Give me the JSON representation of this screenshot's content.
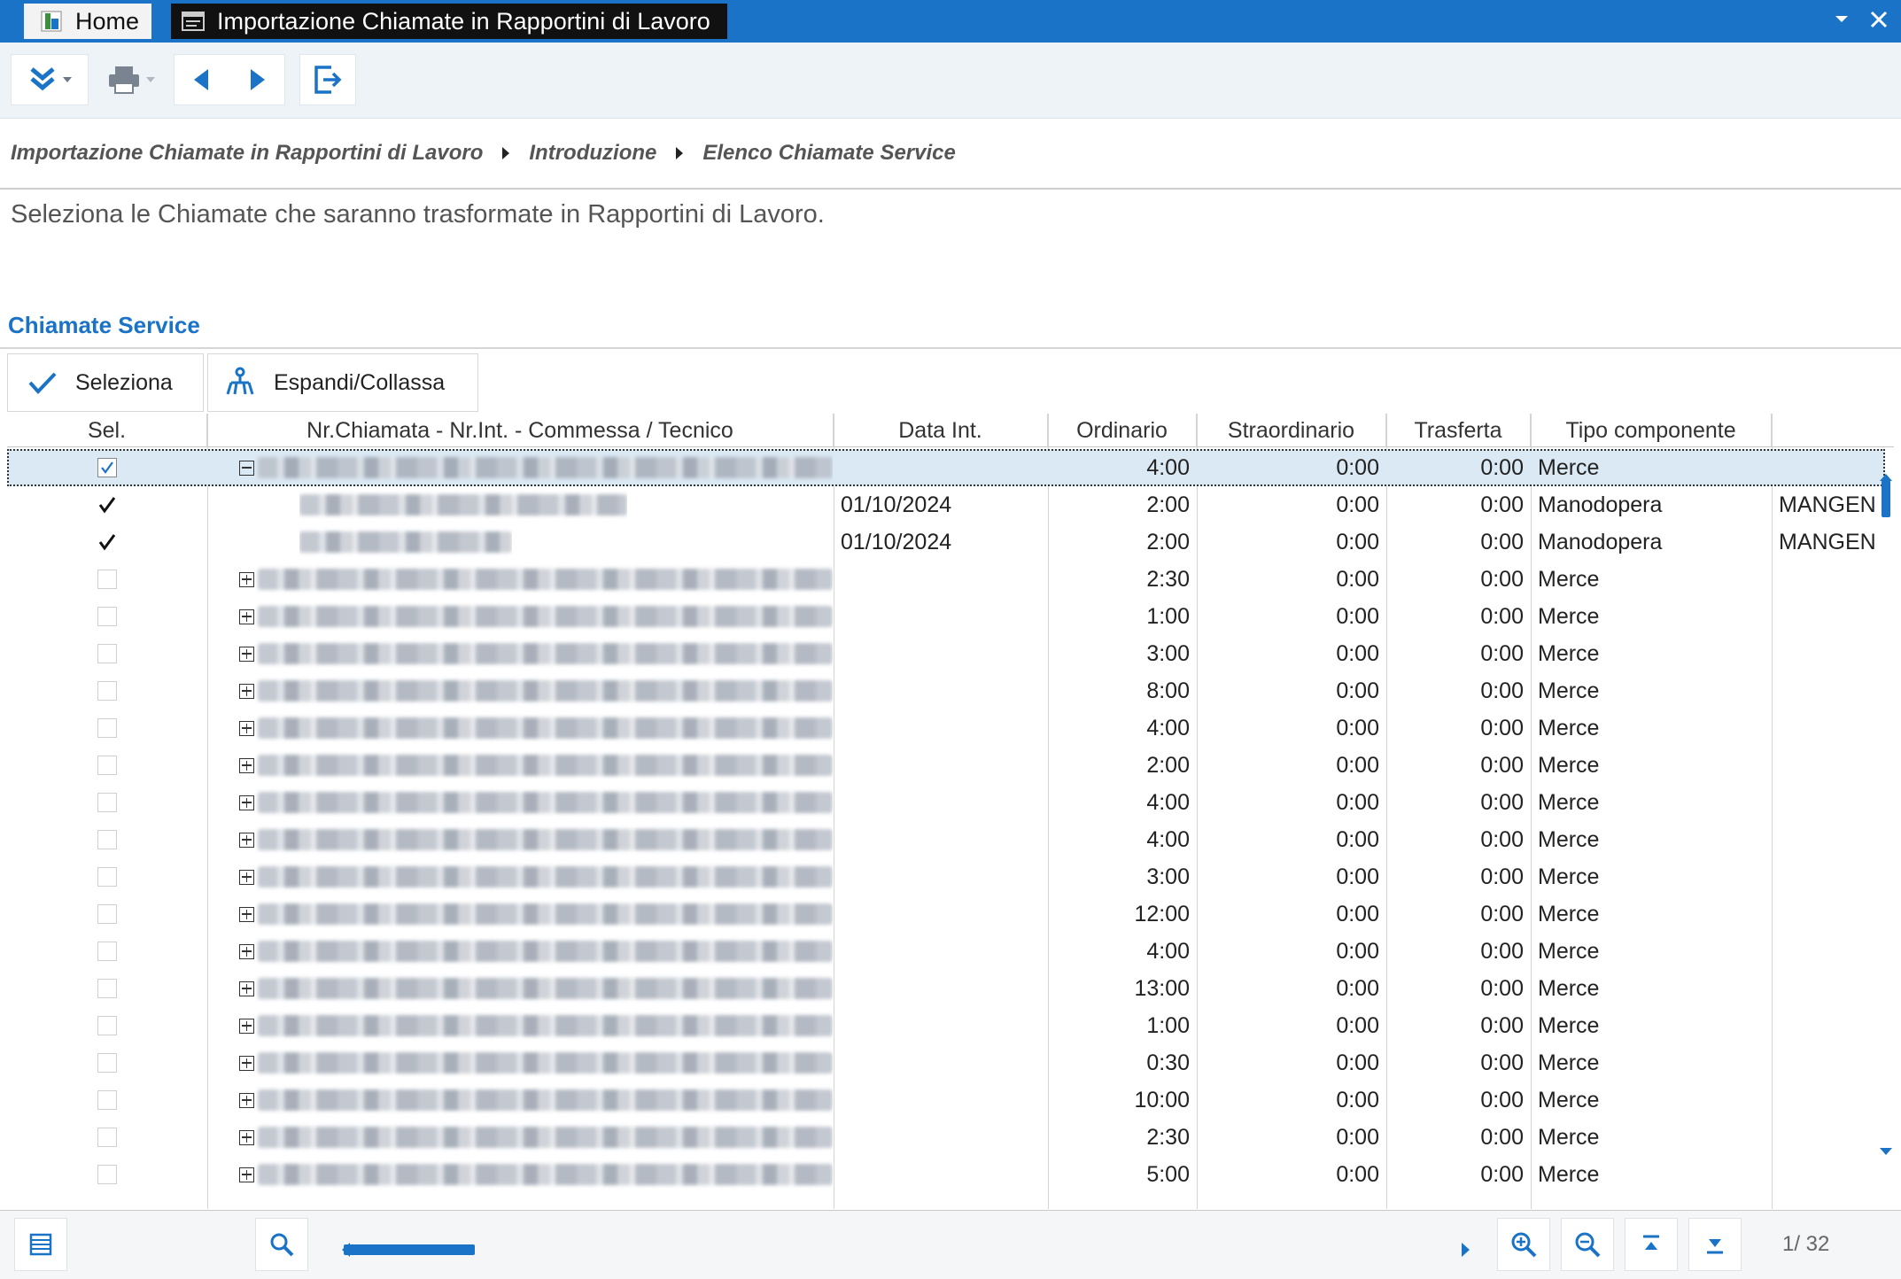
{
  "titlebar": {
    "home_tab": "Home",
    "active_tab": "Importazione Chiamate in Rapportini di Lavoro",
    "accent": "#1a73c7"
  },
  "toolbar": {
    "icons": [
      "expand-all-icon",
      "print-icon",
      "arrow-left-icon",
      "arrow-right-icon",
      "exit-icon"
    ]
  },
  "breadcrumb": {
    "items": [
      "Importazione Chiamate in Rapportini di Lavoro",
      "Introduzione",
      "Elenco Chiamate Service"
    ]
  },
  "intro_text": "Seleziona le Chiamate che saranno trasformate in Rapportini di Lavoro.",
  "section_title": "Chiamate Service",
  "actions": {
    "select_label": "Seleziona",
    "expand_label": "Espandi/Collassa"
  },
  "grid": {
    "columns": [
      "Sel.",
      "Nr.Chiamata - Nr.Int. - Commessa / Tecnico",
      "Data Int.",
      "Ordinario",
      "Straordinario",
      "Trasferta",
      "Tipo componente",
      ""
    ],
    "rows": [
      {
        "sel": "checked-box",
        "tree": "minus",
        "date": "",
        "ord": "4:00",
        "str": "0:00",
        "tra": "0:00",
        "tipo": "Merce",
        "extra": ""
      },
      {
        "sel": "tick",
        "tree": "child",
        "date": "01/10/2024",
        "ord": "2:00",
        "str": "0:00",
        "tra": "0:00",
        "tipo": "Manodopera",
        "extra": "MANGEN"
      },
      {
        "sel": "tick",
        "tree": "child2",
        "date": "01/10/2024",
        "ord": "2:00",
        "str": "0:00",
        "tra": "0:00",
        "tipo": "Manodopera",
        "extra": "MANGEN"
      },
      {
        "sel": "empty",
        "tree": "plus",
        "date": "",
        "ord": "2:30",
        "str": "0:00",
        "tra": "0:00",
        "tipo": "Merce",
        "extra": ""
      },
      {
        "sel": "empty",
        "tree": "plus",
        "date": "",
        "ord": "1:00",
        "str": "0:00",
        "tra": "0:00",
        "tipo": "Merce",
        "extra": ""
      },
      {
        "sel": "empty",
        "tree": "plus",
        "date": "",
        "ord": "3:00",
        "str": "0:00",
        "tra": "0:00",
        "tipo": "Merce",
        "extra": ""
      },
      {
        "sel": "empty",
        "tree": "plus",
        "date": "",
        "ord": "8:00",
        "str": "0:00",
        "tra": "0:00",
        "tipo": "Merce",
        "extra": ""
      },
      {
        "sel": "empty",
        "tree": "plus",
        "date": "",
        "ord": "4:00",
        "str": "0:00",
        "tra": "0:00",
        "tipo": "Merce",
        "extra": ""
      },
      {
        "sel": "empty",
        "tree": "plus",
        "date": "",
        "ord": "2:00",
        "str": "0:00",
        "tra": "0:00",
        "tipo": "Merce",
        "extra": ""
      },
      {
        "sel": "empty",
        "tree": "plus",
        "date": "",
        "ord": "4:00",
        "str": "0:00",
        "tra": "0:00",
        "tipo": "Merce",
        "extra": ""
      },
      {
        "sel": "empty",
        "tree": "plus",
        "date": "",
        "ord": "4:00",
        "str": "0:00",
        "tra": "0:00",
        "tipo": "Merce",
        "extra": ""
      },
      {
        "sel": "empty",
        "tree": "plus",
        "date": "",
        "ord": "3:00",
        "str": "0:00",
        "tra": "0:00",
        "tipo": "Merce",
        "extra": ""
      },
      {
        "sel": "empty",
        "tree": "plus",
        "date": "",
        "ord": "12:00",
        "str": "0:00",
        "tra": "0:00",
        "tipo": "Merce",
        "extra": ""
      },
      {
        "sel": "empty",
        "tree": "plus",
        "date": "",
        "ord": "4:00",
        "str": "0:00",
        "tra": "0:00",
        "tipo": "Merce",
        "extra": ""
      },
      {
        "sel": "empty",
        "tree": "plus",
        "date": "",
        "ord": "13:00",
        "str": "0:00",
        "tra": "0:00",
        "tipo": "Merce",
        "extra": ""
      },
      {
        "sel": "empty",
        "tree": "plus",
        "date": "",
        "ord": "1:00",
        "str": "0:00",
        "tra": "0:00",
        "tipo": "Merce",
        "extra": ""
      },
      {
        "sel": "empty",
        "tree": "plus",
        "date": "",
        "ord": "0:30",
        "str": "0:00",
        "tra": "0:00",
        "tipo": "Merce",
        "extra": ""
      },
      {
        "sel": "empty",
        "tree": "plus",
        "date": "",
        "ord": "10:00",
        "str": "0:00",
        "tra": "0:00",
        "tipo": "Merce",
        "extra": ""
      },
      {
        "sel": "empty",
        "tree": "plus",
        "date": "",
        "ord": "2:30",
        "str": "0:00",
        "tra": "0:00",
        "tipo": "Merce",
        "extra": ""
      },
      {
        "sel": "empty",
        "tree": "plus",
        "date": "",
        "ord": "5:00",
        "str": "0:00",
        "tra": "0:00",
        "tipo": "Merce",
        "extra": ""
      }
    ]
  },
  "footer": {
    "page_info": "1/  32",
    "icons": [
      "list-icon",
      "search-icon",
      "zoom-in-icon",
      "zoom-out-icon",
      "go-first-icon",
      "go-last-icon"
    ]
  }
}
